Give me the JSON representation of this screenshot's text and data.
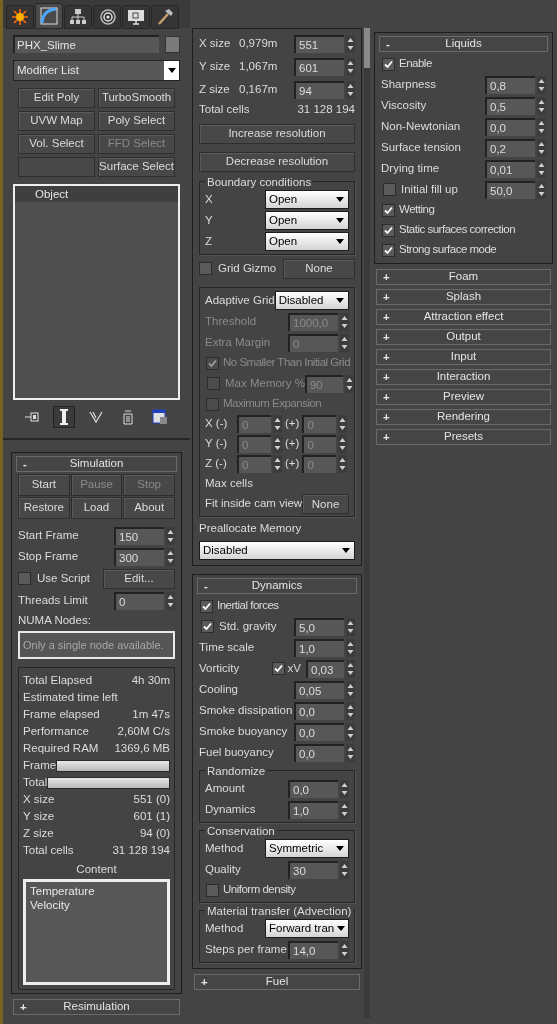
{
  "command_tabs": [
    {
      "selected": false
    },
    {
      "selected": true
    },
    {
      "selected": false
    },
    {
      "selected": false
    },
    {
      "selected": false
    },
    {
      "selected": false
    }
  ],
  "object_name": "PHX_Slime",
  "modifier_list": "Modifier List",
  "modifier_buttons": [
    {
      "label": "Edit Poly",
      "disabled": false
    },
    {
      "label": "TurboSmooth",
      "disabled": false
    },
    {
      "label": "UVW Map",
      "disabled": false
    },
    {
      "label": "Poly Select",
      "disabled": false
    },
    {
      "label": "Vol. Select",
      "disabled": false
    },
    {
      "label": "FFD Select",
      "disabled": true
    },
    {
      "kind": "blank"
    },
    {
      "label": "Surface Select",
      "disabled": false
    }
  ],
  "stack": [
    "Object"
  ],
  "stack_tools": [
    {
      "pressed": false
    },
    {
      "pressed": true
    },
    {
      "pressed": false
    },
    {
      "pressed": false
    },
    {
      "pressed": false
    }
  ],
  "left_rollouts": [
    {
      "sign": "-",
      "title": "Simulation",
      "rows": [
        {
          "kind": "button_grid",
          "buttons": [
            {
              "label": "Start",
              "disabled": false
            },
            {
              "label": "Pause",
              "disabled": true
            },
            {
              "label": "Stop",
              "disabled": true
            },
            {
              "label": "Restore",
              "disabled": false
            },
            {
              "label": "Load",
              "disabled": false
            },
            {
              "label": "About",
              "disabled": false
            }
          ]
        },
        {
          "kind": "spinner",
          "label": "Start Frame",
          "value": "150",
          "disabled": false
        },
        {
          "kind": "spinner",
          "label": "Stop Frame",
          "value": "300",
          "disabled": false
        },
        {
          "kind": "check_button",
          "label": "Use Script",
          "checked": false,
          "button": "Edit..."
        },
        {
          "kind": "spinner",
          "label": "Threads Limit",
          "value": "0",
          "disabled": false
        },
        {
          "kind": "label",
          "text": "NUMA Nodes:"
        },
        {
          "kind": "field",
          "placeholder": "Only a single node available."
        },
        {
          "kind": "stats",
          "items": [
            {
              "kind": "stat",
              "label": "Total Elapsed",
              "value": "4h 30m"
            },
            {
              "kind": "stat",
              "label": "Estimated time left"
            },
            {
              "kind": "stat",
              "label": "Frame elapsed",
              "value": "1m 47s"
            },
            {
              "kind": "stat",
              "label": "Performance",
              "value": "2,60M C/s"
            },
            {
              "kind": "stat",
              "label": "Required RAM",
              "value": "1369,6 MB"
            },
            {
              "kind": "bar",
              "label": "Frame",
              "level": 1
            },
            {
              "kind": "bar",
              "label": "Total",
              "level": 1
            },
            {
              "kind": "stat",
              "label": "X size",
              "value": "551 (0)"
            },
            {
              "kind": "stat",
              "label": "Y size",
              "value": "601 (1)"
            },
            {
              "kind": "stat",
              "label": "Z size",
              "value": "94 (0)"
            },
            {
              "kind": "stat",
              "label": "Total cells",
              "value": "31 128 194"
            }
          ],
          "content": {
            "title": "Content",
            "items": [
              "Temperature",
              "Velocity"
            ]
          }
        }
      ]
    },
    {
      "sign": "+",
      "title": "Resimulation"
    }
  ],
  "grid_rows": [
    {
      "kind": "size",
      "label": "X size",
      "reading": "0,979m",
      "value": "551"
    },
    {
      "kind": "size",
      "label": "Y size",
      "reading": "1,067m",
      "value": "601"
    },
    {
      "kind": "size",
      "label": "Z size",
      "reading": "0,167m",
      "value": "94"
    },
    {
      "kind": "stat",
      "label": "Total cells",
      "value": "31 128 194"
    },
    {
      "kind": "wide_button",
      "label": "Increase resolution"
    },
    {
      "kind": "wide_button",
      "label": "Decrease resolution"
    },
    {
      "kind": "group",
      "title": "Boundary conditions",
      "rows": [
        {
          "kind": "dropdown",
          "label": "X",
          "value": "Open"
        },
        {
          "kind": "dropdown",
          "label": "Y",
          "value": "Open"
        },
        {
          "kind": "dropdown",
          "label": "Z",
          "value": "Open"
        }
      ]
    },
    {
      "kind": "check_button",
      "label": "Grid Gizmo",
      "checked": false,
      "button": "None"
    },
    {
      "kind": "group",
      "rows": [
        {
          "kind": "dropdown",
          "label": "Adaptive Grid",
          "value": "Disabled"
        },
        {
          "kind": "spinner",
          "label": "Threshold",
          "value": "1000,0",
          "disabled": true
        },
        {
          "kind": "spinner",
          "label": "Extra Margin",
          "value": "0",
          "disabled": true
        },
        {
          "kind": "checkbox",
          "label": "No Smaller Than Initial Grid",
          "checked": true,
          "disabled": true
        },
        {
          "kind": "check_spinner",
          "label": "Max Memory %",
          "checked": false,
          "value": "90",
          "disabled": true
        },
        {
          "kind": "checkbox",
          "label": "Maximum Expansion",
          "checked": false,
          "disabled": true
        },
        {
          "kind": "expansion",
          "label": "X (-)",
          "value": "0",
          "plus": "(+)",
          "value2": "0",
          "disabled": true
        },
        {
          "kind": "expansion",
          "label": "Y (-)",
          "value": "0",
          "plus": "(+)",
          "value2": "0",
          "disabled": true
        },
        {
          "kind": "expansion",
          "label": "Z (-)",
          "value": "0",
          "plus": "(+)",
          "value2": "0",
          "disabled": true
        },
        {
          "kind": "label",
          "text": "Max cells"
        },
        {
          "kind": "label_button",
          "label": "Fit inside cam view",
          "button": "None"
        }
      ]
    },
    {
      "kind": "label",
      "text": "Preallocate Memory"
    },
    {
      "kind": "dropdown_full",
      "value": "Disabled"
    }
  ],
  "middle_rollouts": [
    {
      "sign": "-",
      "title": "Dynamics",
      "rows": [
        {
          "kind": "checkbox",
          "label": "Inertial forces",
          "checked": true,
          "disabled": false
        },
        {
          "kind": "check_spinner",
          "label": "Std. gravity",
          "checked": true,
          "value": "5,0",
          "disabled": false
        },
        {
          "kind": "spinner",
          "label": "Time scale",
          "value": "1,0",
          "disabled": false
        },
        {
          "kind": "check_inline",
          "label": "Vorticity",
          "check_label": "xV",
          "checked": true,
          "value": "0,03"
        },
        {
          "kind": "spinner",
          "label": "Cooling",
          "value": "0,05",
          "disabled": false
        },
        {
          "kind": "spinner",
          "label": "Smoke dissipation",
          "value": "0,0",
          "disabled": false
        },
        {
          "kind": "spinner",
          "label": "Smoke buoyancy",
          "value": "0,0",
          "disabled": false
        },
        {
          "kind": "spinner",
          "label": "Fuel buoyancy",
          "value": "0,0",
          "disabled": false
        },
        {
          "kind": "group",
          "title": "Randomize",
          "rows": [
            {
              "kind": "spinner",
              "label": "Amount",
              "value": "0,0",
              "disabled": false
            },
            {
              "kind": "spinner",
              "label": "Dynamics",
              "value": "1,0",
              "disabled": false
            }
          ]
        },
        {
          "kind": "group",
          "title": "Conservation",
          "rows": [
            {
              "kind": "dropdown",
              "label": "Method",
              "value": "Symmetric"
            },
            {
              "kind": "spinner",
              "label": "Quality",
              "value": "30",
              "disabled": false
            },
            {
              "kind": "checkbox",
              "label": "Uniform density",
              "checked": false,
              "disabled": false
            }
          ]
        },
        {
          "kind": "group",
          "title": "Material transfer (Advection)",
          "rows": [
            {
              "kind": "dropdown",
              "label": "Method",
              "value": "Forward tran"
            },
            {
              "kind": "spinner",
              "label": "Steps per frame",
              "value": "14,0",
              "disabled": false
            }
          ]
        }
      ]
    },
    {
      "sign": "+",
      "title": "Fuel"
    }
  ],
  "right_rollouts": [
    {
      "sign": "-",
      "title": "Liquids",
      "rows": [
        {
          "kind": "checkbox",
          "label": "Enable",
          "checked": true,
          "disabled": false
        },
        {
          "kind": "spinner",
          "label": "Sharpness",
          "value": "0,8",
          "disabled": false
        },
        {
          "kind": "spinner",
          "label": "Viscosity",
          "value": "0,5",
          "disabled": false
        },
        {
          "kind": "spinner",
          "label": "Non-Newtonian",
          "value": "0,0",
          "disabled": false
        },
        {
          "kind": "spinner",
          "label": "Surface tension",
          "value": "0,2",
          "disabled": false
        },
        {
          "kind": "spinner",
          "label": "Drying time",
          "value": "0,01",
          "disabled": false
        },
        {
          "kind": "check_spinner",
          "label": "Initial fill up",
          "checked": false,
          "value": "50,0",
          "disabled": false
        },
        {
          "kind": "checkbox",
          "label": "Wetting",
          "checked": true,
          "disabled": false
        },
        {
          "kind": "checkbox",
          "label": "Static surfaces correction",
          "checked": true,
          "disabled": false
        },
        {
          "kind": "checkbox",
          "label": "Strong surface mode",
          "checked": true,
          "disabled": false
        }
      ]
    },
    {
      "sign": "+",
      "title": "Foam"
    },
    {
      "sign": "+",
      "title": "Splash"
    },
    {
      "sign": "+",
      "title": "Attraction effect"
    },
    {
      "sign": "+",
      "title": "Output"
    },
    {
      "sign": "+",
      "title": "Input"
    },
    {
      "sign": "+",
      "title": "Interaction"
    },
    {
      "sign": "+",
      "title": "Preview"
    },
    {
      "sign": "+",
      "title": "Rendering"
    },
    {
      "sign": "+",
      "title": "Presets"
    }
  ]
}
